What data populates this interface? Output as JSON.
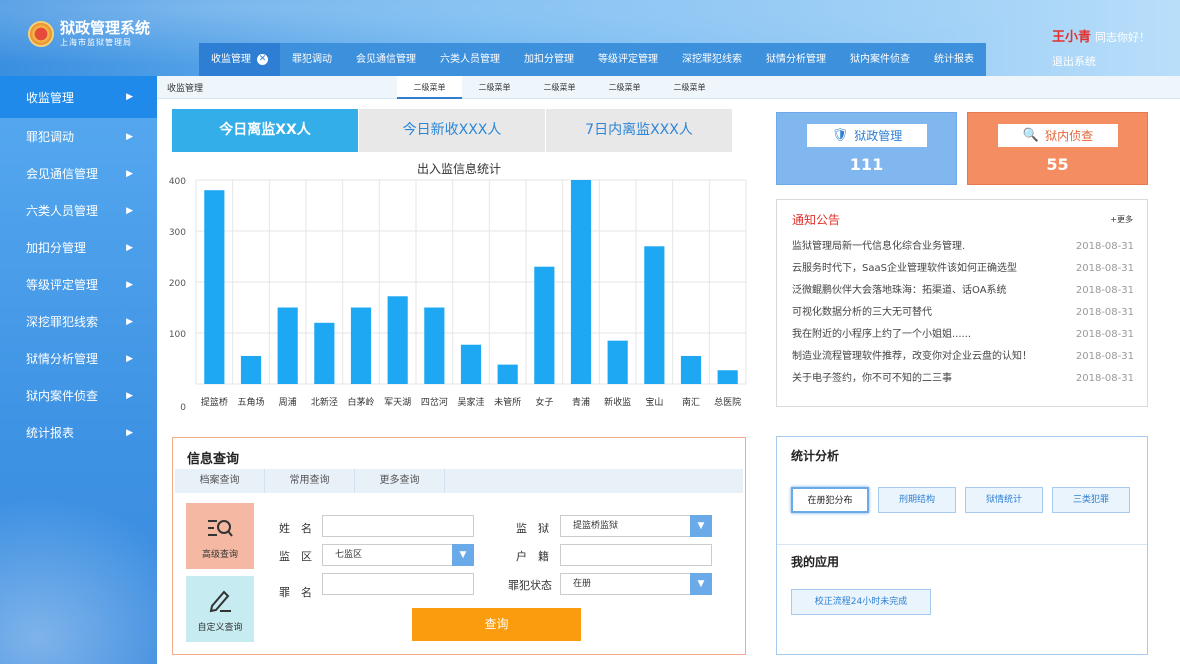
{
  "header": {
    "logo_title": "狱政管理系统",
    "logo_sub": "上海市监狱管理局",
    "user_name": "王小青",
    "greeting": "同志你好！",
    "logout": "退出系统",
    "tabs": [
      "收监管理",
      "罪犯调动",
      "会见通信管理",
      "六类人员管理",
      "加扣分管理",
      "等级评定管理",
      "深挖罪犯线索",
      "狱情分析管理",
      "狱内案件侦查",
      "统计报表"
    ]
  },
  "sidebar": {
    "items": [
      "收监管理",
      "罪犯调动",
      "会见通信管理",
      "六类人员管理",
      "加扣分管理",
      "等级评定管理",
      "深挖罪犯线索",
      "狱情分析管理",
      "狱内案件侦查",
      "统计报表"
    ]
  },
  "breadcrumb": {
    "title": "收监管理",
    "subtabs": [
      "二级菜单",
      "二级菜单",
      "二级菜单",
      "二级菜单",
      "二级菜单"
    ]
  },
  "stats": [
    "今日离监XX人",
    "今日新收XXX人",
    "7日内离监XXX人"
  ],
  "chart_data": {
    "type": "bar",
    "title": "出入监信息统计",
    "categories": [
      "提篮桥",
      "五角场",
      "周浦",
      "北新泾",
      "白茅岭",
      "军天湖",
      "四岔河",
      "吴家洼",
      "未管所",
      "女子",
      "青浦",
      "新收监",
      "宝山",
      "南汇",
      "总医院"
    ],
    "values": [
      380,
      55,
      150,
      120,
      150,
      172,
      150,
      77,
      38,
      230,
      410,
      85,
      270,
      55,
      27
    ],
    "ylim": [
      0,
      400
    ],
    "yticks": [
      "0",
      "100",
      "200",
      "300",
      "400"
    ],
    "grid": true,
    "color": "#1ea7f2"
  },
  "cards": {
    "prison": {
      "label": "狱政管理",
      "value": "111"
    },
    "case": {
      "label": "狱内侦查",
      "value": "55"
    }
  },
  "notice": {
    "title": "通知公告",
    "more": "+更多",
    "items": [
      {
        "title": "监狱管理局新一代信息化综合业务管理.",
        "date": "2018-08-31"
      },
      {
        "title": "云服务时代下，SaaS企业管理软件该如何正确选型",
        "date": "2018-08-31"
      },
      {
        "title": "泛微鲲鹏伙伴大会落地珠海：拓渠道、话OA系统",
        "date": "2018-08-31"
      },
      {
        "title": "可视化数据分析的三大无可替代",
        "date": "2018-08-31"
      },
      {
        "title": "我在附近的小程序上约了一个小姐姐......",
        "date": "2018-08-31"
      },
      {
        "title": "制造业流程管理软件推荐，改变你对企业云盘的认知！",
        "date": "2018-08-31"
      },
      {
        "title": "关于电子签约，你不可不知的二三事",
        "date": "2018-08-31"
      }
    ]
  },
  "query": {
    "title": "信息查询",
    "tabs": [
      "档案查询",
      "常用查询",
      "更多查询"
    ],
    "adv_label": "高级查询",
    "custom_label": "自定义查询",
    "name_label": "姓　名",
    "name_value": "",
    "area_label": "监　区",
    "area_value": "七监区",
    "crime_label": "罪　名",
    "crime_value": "",
    "prison_label": "监　狱",
    "prison_value": "提篮桥监狱",
    "household_label": "户　籍",
    "household_value": "",
    "status_label": "罪犯状态",
    "status_value": "在册",
    "search_label": "查询"
  },
  "analysis": {
    "title": "统计分析",
    "tabs": [
      "在册犯分布",
      "刑期结构",
      "狱情统计",
      "三类犯罪"
    ],
    "apps_title": "我的应用",
    "app_btn": "校正流程24小时未完成"
  }
}
